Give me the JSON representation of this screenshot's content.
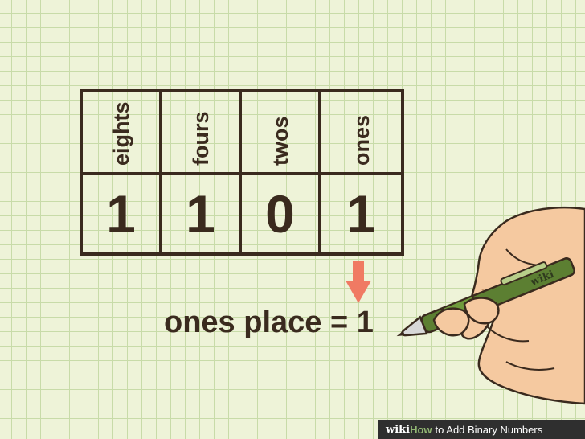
{
  "table": {
    "headers": [
      "eights",
      "fours",
      "twos",
      "ones"
    ],
    "digits": [
      "1",
      "1",
      "0",
      "1"
    ]
  },
  "caption": "ones place = 1",
  "pen_brand": "wiki",
  "footer": {
    "wiki": "wiki",
    "how": "How",
    "title": "to Add Binary Numbers"
  },
  "colors": {
    "ink": "#3a2a1e",
    "arrow": "#f07a63",
    "paper": "#eef3d8",
    "grid": "#c8dba8",
    "pen": "#5c7f32"
  },
  "icons": [
    "down-arrow-icon",
    "hand-with-pen-illustration"
  ]
}
